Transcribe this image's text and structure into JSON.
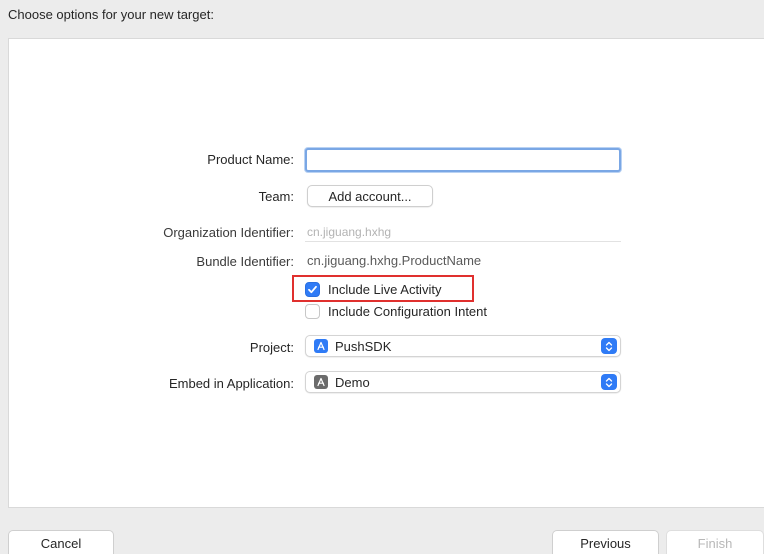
{
  "header": {
    "title": "Choose options for your new target:"
  },
  "form": {
    "product_name": {
      "label": "Product Name:",
      "value": ""
    },
    "team": {
      "label": "Team:",
      "button_label": "Add account..."
    },
    "organization_identifier": {
      "label": "Organization Identifier:",
      "value": "cn.jiguang.hxhg"
    },
    "bundle_identifier": {
      "label": "Bundle Identifier:",
      "value": "cn.jiguang.hxhg.ProductName"
    },
    "include_live_activity": {
      "label": "Include Live Activity",
      "checked": true
    },
    "include_configuration_intent": {
      "label": "Include Configuration Intent",
      "checked": false
    },
    "project": {
      "label": "Project:",
      "value": "PushSDK",
      "icon": "app-store-icon"
    },
    "embed_in_application": {
      "label": "Embed in Application:",
      "value": "Demo",
      "icon": "app-store-icon"
    }
  },
  "footer": {
    "cancel_label": "Cancel",
    "previous_label": "Previous",
    "finish_label": "Finish"
  },
  "colors": {
    "accent": "#2f7bf6",
    "highlight": "#e0302e",
    "focus_ring": "#7aa7e5"
  }
}
